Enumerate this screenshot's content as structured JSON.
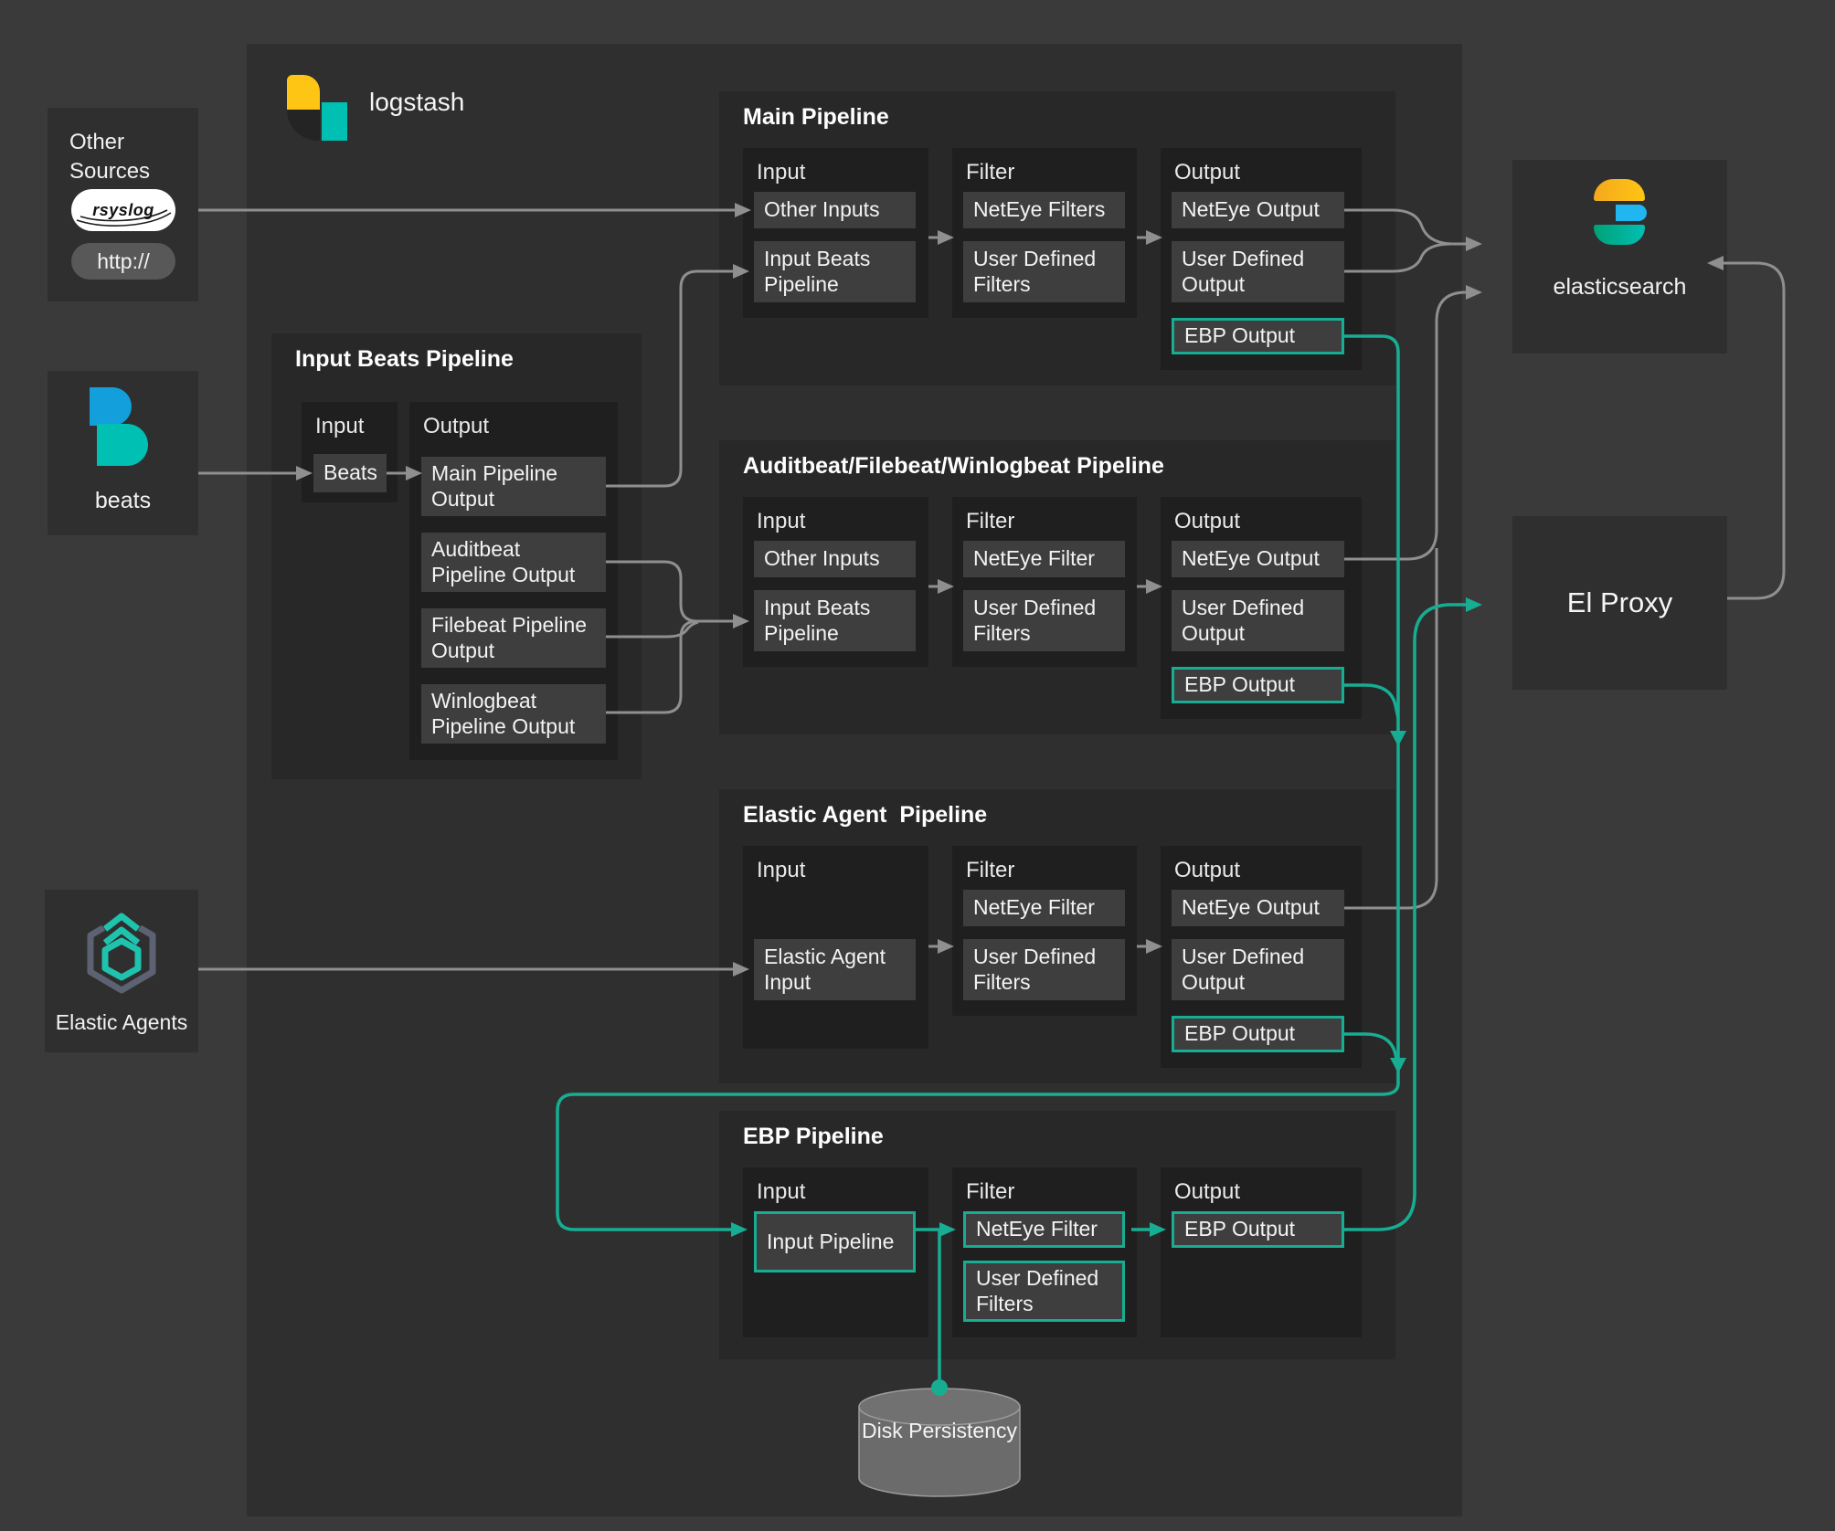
{
  "colors": {
    "accent": "#17ad92",
    "wire": "#8f8f8f",
    "background": "#3a3a3a"
  },
  "icons": {
    "logstash": "logstash-logo",
    "beats": "beats-logo",
    "elasticsearch": "elasticsearch-logo",
    "elastic_agents": "elastic-agent-hexagon",
    "rsyslog": "rsyslog-badge",
    "disk": "database-cylinder"
  },
  "left": {
    "other_sources": {
      "title": "Other Sources",
      "rsyslog": "rsyslog",
      "http": "http://"
    },
    "beats": {
      "label": "beats"
    },
    "elastic_agents": {
      "label": "Elastic Agents"
    }
  },
  "logstash": {
    "label": "logstash"
  },
  "input_beats_pipeline": {
    "title": "Input Beats Pipeline",
    "input_label": "Input",
    "output_label": "Output",
    "input_items": [
      {
        "label": "Beats",
        "lines": 1
      }
    ],
    "output_items": [
      {
        "label": "Main Pipeline Output",
        "lines": 2
      },
      {
        "label": "Auditbeat Pipeline Output",
        "lines": 2
      },
      {
        "label": "Filebeat Pipeline Output",
        "lines": 2
      },
      {
        "label": "Winlogbeat Pipeline Output",
        "lines": 2
      }
    ]
  },
  "pipelines": [
    {
      "id": "main",
      "title": "Main Pipeline",
      "columns": [
        {
          "label": "Input",
          "items": [
            {
              "label": "Other Inputs",
              "slot": 0,
              "lines": 1
            },
            {
              "label": "Input Beats Pipeline",
              "slot": 1,
              "lines": 2
            }
          ]
        },
        {
          "label": "Filter",
          "items": [
            {
              "label": "NetEye Filters",
              "slot": 0,
              "lines": 1
            },
            {
              "label": "User Defined Filters",
              "slot": 1,
              "lines": 2
            }
          ]
        },
        {
          "label": "Output",
          "items": [
            {
              "label": "NetEye Output",
              "slot": 0,
              "lines": 1
            },
            {
              "label": "User Defined Output",
              "slot": 1,
              "lines": 2
            },
            {
              "label": "EBP Output",
              "slot": 2,
              "lines": 1,
              "accent": true
            }
          ]
        }
      ]
    },
    {
      "id": "beats-pipeline",
      "title": "Auditbeat/Filebeat/Winlogbeat Pipeline",
      "columns": [
        {
          "label": "Input",
          "items": [
            {
              "label": "Other Inputs",
              "slot": 0,
              "lines": 1
            },
            {
              "label": "Input Beats Pipeline",
              "slot": 1,
              "lines": 2
            }
          ]
        },
        {
          "label": "Filter",
          "items": [
            {
              "label": "NetEye Filter",
              "slot": 0,
              "lines": 1
            },
            {
              "label": "User Defined Filters",
              "slot": 1,
              "lines": 2
            }
          ]
        },
        {
          "label": "Output",
          "items": [
            {
              "label": "NetEye Output",
              "slot": 0,
              "lines": 1
            },
            {
              "label": "User Defined Output",
              "slot": 1,
              "lines": 2
            },
            {
              "label": "EBP Output",
              "slot": 2,
              "lines": 1,
              "accent": true
            }
          ]
        }
      ]
    },
    {
      "id": "elastic-agent",
      "title": "Elastic Agent  Pipeline",
      "columns": [
        {
          "label": "Input",
          "items": [
            {
              "label": "Elastic Agent Input",
              "slot": 1,
              "lines": 2
            }
          ]
        },
        {
          "label": "Filter",
          "items": [
            {
              "label": "NetEye Filter",
              "slot": 0,
              "lines": 1
            },
            {
              "label": "User Defined Filters",
              "slot": 1,
              "lines": 2
            }
          ]
        },
        {
          "label": "Output",
          "items": [
            {
              "label": "NetEye Output",
              "slot": 0,
              "lines": 1
            },
            {
              "label": "User Defined Output",
              "slot": 1,
              "lines": 2
            },
            {
              "label": "EBP Output",
              "slot": 2,
              "lines": 1,
              "accent": true
            }
          ]
        }
      ]
    },
    {
      "id": "ebp",
      "title": "EBP Pipeline",
      "columns": [
        {
          "label": "Input",
          "items": [
            {
              "label": "Input Pipeline",
              "slot": 0,
              "lines": 2,
              "accent": true
            }
          ]
        },
        {
          "label": "Filter",
          "items": [
            {
              "label": "NetEye Filter",
              "slot": 0,
              "lines": 1,
              "accent": true
            },
            {
              "label": "User Defined Filters",
              "slot": 1,
              "lines": 2,
              "accent": true
            }
          ]
        },
        {
          "label": "Output",
          "items": [
            {
              "label": "EBP Output",
              "slot": 0,
              "lines": 1,
              "accent": true
            }
          ]
        }
      ]
    }
  ],
  "right": {
    "elasticsearch": {
      "label": "elasticsearch"
    },
    "el_proxy": {
      "label": "El Proxy"
    }
  },
  "disk": {
    "label": "Disk Persistency"
  }
}
